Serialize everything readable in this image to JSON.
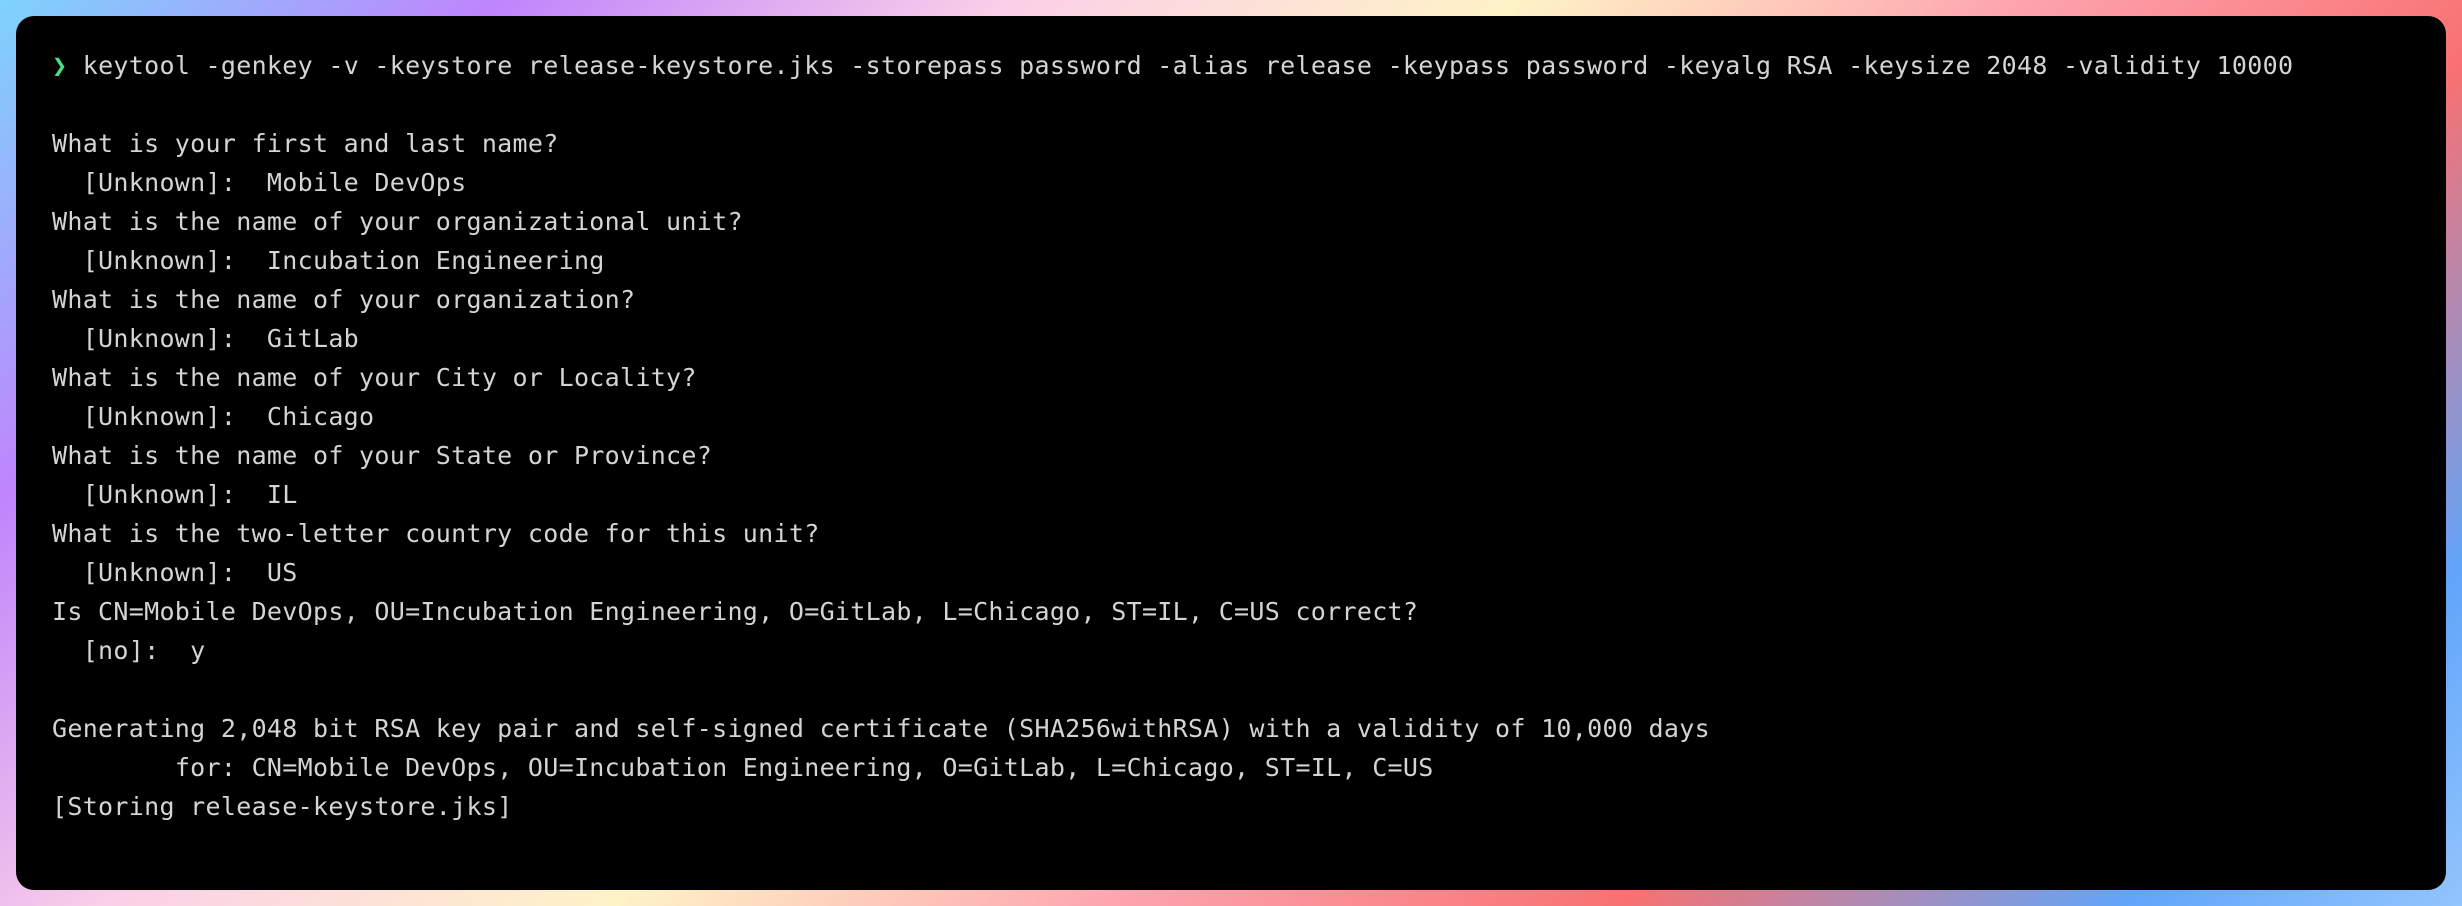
{
  "prompt": "❯",
  "command": "keytool -genkey -v -keystore release-keystore.jks -storepass password -alias release -keypass password -keyalg RSA -keysize 2048 -validity 10000",
  "prompts": [
    {
      "question": "What is your first and last name?",
      "default": "[Unknown]:",
      "answer": "Mobile DevOps"
    },
    {
      "question": "What is the name of your organizational unit?",
      "default": "[Unknown]:",
      "answer": "Incubation Engineering"
    },
    {
      "question": "What is the name of your organization?",
      "default": "[Unknown]:",
      "answer": "GitLab"
    },
    {
      "question": "What is the name of your City or Locality?",
      "default": "[Unknown]:",
      "answer": "Chicago"
    },
    {
      "question": "What is the name of your State or Province?",
      "default": "[Unknown]:",
      "answer": "IL"
    },
    {
      "question": "What is the two-letter country code for this unit?",
      "default": "[Unknown]:",
      "answer": "US"
    }
  ],
  "confirm": {
    "question": "Is CN=Mobile DevOps, OU=Incubation Engineering, O=GitLab, L=Chicago, ST=IL, C=US correct?",
    "default": "[no]:",
    "answer": "y"
  },
  "output": {
    "line1": "Generating 2,048 bit RSA key pair and self-signed certificate (SHA256withRSA) with a validity of 10,000 days",
    "line2": "        for: CN=Mobile DevOps, OU=Incubation Engineering, O=GitLab, L=Chicago, ST=IL, C=US",
    "line3": "[Storing release-keystore.jks]"
  }
}
